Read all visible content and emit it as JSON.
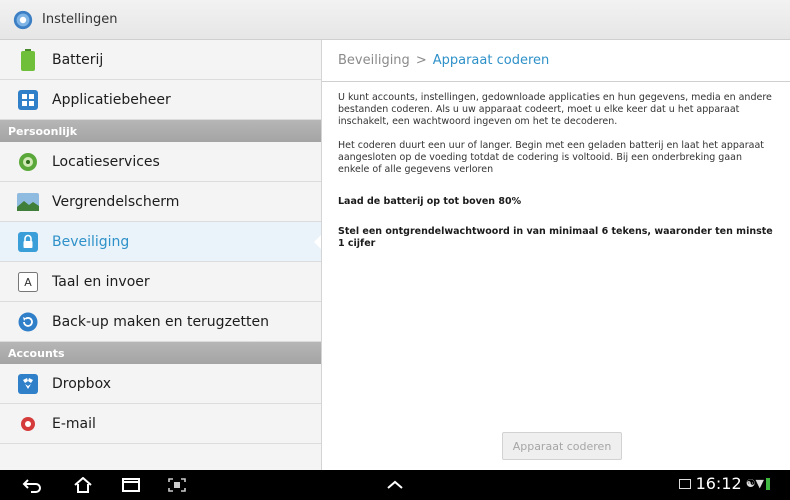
{
  "titlebar": {
    "title": "Instellingen",
    "icon": "settings-gear-icon"
  },
  "sidebar": {
    "items": [
      {
        "label": "Batterij",
        "icon": "battery-icon"
      },
      {
        "label": "Applicatiebeheer",
        "icon": "app-grid-icon"
      }
    ],
    "section_personal": "Persoonlijk",
    "personal_items": [
      {
        "label": "Locatieservices",
        "icon": "location-icon"
      },
      {
        "label": "Vergrendelscherm",
        "icon": "lockscreen-icon"
      },
      {
        "label": "Beveiliging",
        "icon": "lock-icon",
        "selected": true
      },
      {
        "label": "Taal en invoer",
        "icon": "keyboard-letter-icon"
      },
      {
        "label": "Back-up maken en terugzetten",
        "icon": "backup-icon"
      }
    ],
    "section_accounts": "Accounts",
    "account_items": [
      {
        "label": "Dropbox",
        "icon": "dropbox-icon"
      },
      {
        "label": "E-mail",
        "icon": "email-icon"
      }
    ]
  },
  "content": {
    "breadcrumb_parent": "Beveiliging",
    "breadcrumb_sep": ">",
    "breadcrumb_current": "Apparaat coderen",
    "paragraph1": "U kunt accounts, instellingen, gedownloade applicaties en hun gegevens, media en andere bestanden coderen. Als u uw apparaat codeert, moet u elke keer dat u het apparaat inschakelt, een wachtwoord ingeven om het te decoderen.",
    "paragraph2": "Het coderen duurt een uur of langer. Begin met een geladen batterij en laat het apparaat aangesloten op de voeding totdat de codering is voltooid. Bij een onderbreking gaan enkele of alle gegevens verloren",
    "requirement1": "Laad de batterij op tot boven 80%",
    "requirement2": "Stel een ontgrendelwachtwoord in van minimaal 6 tekens, waaronder ten minste 1 cijfer",
    "button_label": "Apparaat coderen"
  },
  "navbar": {
    "time": "16:12",
    "buttons": [
      "back-icon",
      "home-icon",
      "recent-apps-icon",
      "screenshot-icon",
      "chevron-up-icon"
    ]
  }
}
